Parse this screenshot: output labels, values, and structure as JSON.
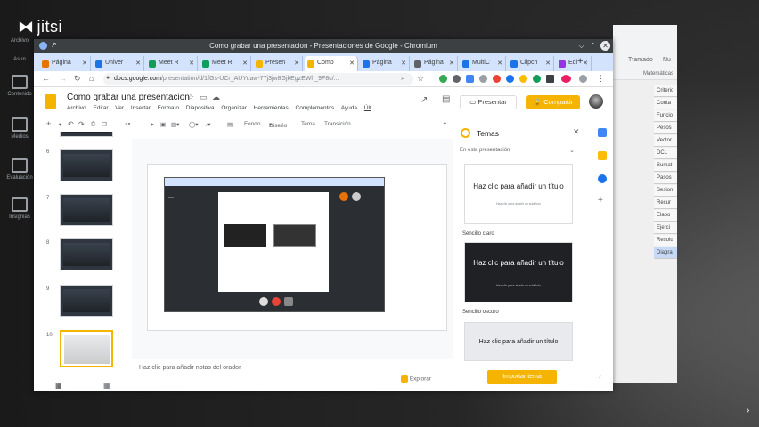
{
  "jitsi": {
    "logo": "jitsi",
    "sidebar": [
      {
        "label": "Archivo"
      },
      {
        "label": "Asun"
      },
      {
        "label": "Contenido"
      },
      {
        "label": "Medios"
      },
      {
        "label": "Evaluación"
      },
      {
        "label": "Insignias"
      }
    ]
  },
  "background_sheet": {
    "menu": [
      "Tramado",
      "Nu"
    ],
    "cells": [
      "Matemáticas",
      "Criterio",
      "Conta",
      "Funcio",
      "Pesos",
      "Vector",
      "DCL",
      "Sumat",
      "Pasos",
      "Sesion",
      "Recur",
      "Elabo",
      "Ejerci",
      "Resolu",
      "Diagra"
    ]
  },
  "window": {
    "title": "Como grabar una presentacion - Presentaciones de Google - Chromium",
    "url_domain": "docs.google.com",
    "url_rest": "/presentation/d/1fGs-UCr_AUYuaw-77j3jw8GjkEgzEWh_9F8c/...",
    "tabs": [
      {
        "label": "Página",
        "color": "#e37400"
      },
      {
        "label": "Univer",
        "color": "#1a73e8"
      },
      {
        "label": "Meet R",
        "color": "#0f9d58"
      },
      {
        "label": "Meet R",
        "color": "#0f9d58"
      },
      {
        "label": "Presen",
        "color": "#f4b400"
      },
      {
        "label": "Como",
        "color": "#f4b400",
        "active": true
      },
      {
        "label": "Página",
        "color": "#1a73e8"
      },
      {
        "label": "Página",
        "color": "#5f6368"
      },
      {
        "label": "MultiC",
        "color": "#1a73e8"
      },
      {
        "label": "Clipch",
        "color": "#1a73e8"
      },
      {
        "label": "Edi",
        "color": "#9334e6"
      }
    ]
  },
  "slides": {
    "doc_title": "Como grabar una presentacion",
    "menu": [
      "Archivo",
      "Editar",
      "Ver",
      "Insertar",
      "Formato",
      "Diapositiva",
      "Organizar",
      "Herramientas",
      "Complementos",
      "Ayuda",
      "Últ"
    ],
    "present_label": "Presentar",
    "share_label": "Compartir",
    "toolbar": [
      "Fondo",
      "Diseño",
      "Tema",
      "Transición"
    ],
    "thumbnails": [
      {
        "num": "6"
      },
      {
        "num": "7"
      },
      {
        "num": "8"
      },
      {
        "num": "9"
      },
      {
        "num": "10",
        "selected": true
      }
    ],
    "notes_placeholder": "Haz clic para añadir notas del orador",
    "explore_label": "Explorar"
  },
  "themes": {
    "title": "Temas",
    "subtitle": "En esta presentación",
    "cards": [
      {
        "title": "Haz clic para añadir un título",
        "subtitle": "Haz clic para añadir un subtítulo",
        "bg": "#ffffff",
        "fg": "#202124"
      },
      {
        "label": "Sencillo claro",
        "title": "Haz clic para añadir un título",
        "subtitle": "Haz clic para añadir un subtítulo",
        "bg": "#202124",
        "fg": "#ffffff"
      },
      {
        "label": "Sencillo oscuro",
        "title": "Haz clic para añadir un título",
        "bg": "#e8eaed",
        "fg": "#202124"
      }
    ],
    "import_label": "Importar tema"
  }
}
